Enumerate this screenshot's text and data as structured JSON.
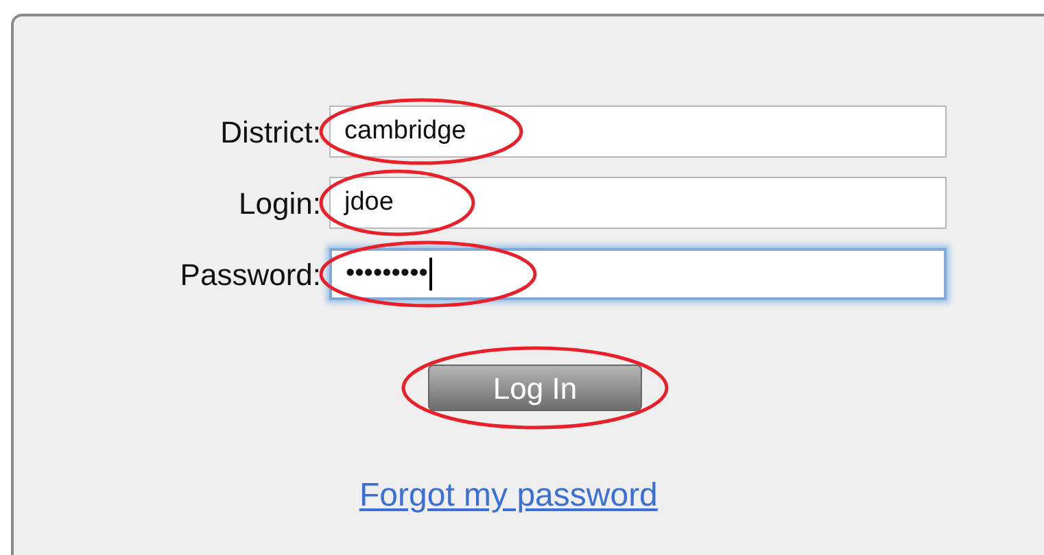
{
  "fields": [
    {
      "label": "District:",
      "value": "cambridge",
      "focused": false,
      "circled": true
    },
    {
      "label": "Login:",
      "value": "jdoe",
      "focused": false,
      "circled": true
    },
    {
      "label": "Password:",
      "value": "•••••••••",
      "focused": true,
      "circled": true
    }
  ],
  "login_button": {
    "label": "Log In",
    "circled": true
  },
  "forgot_link": "Forgot my password"
}
